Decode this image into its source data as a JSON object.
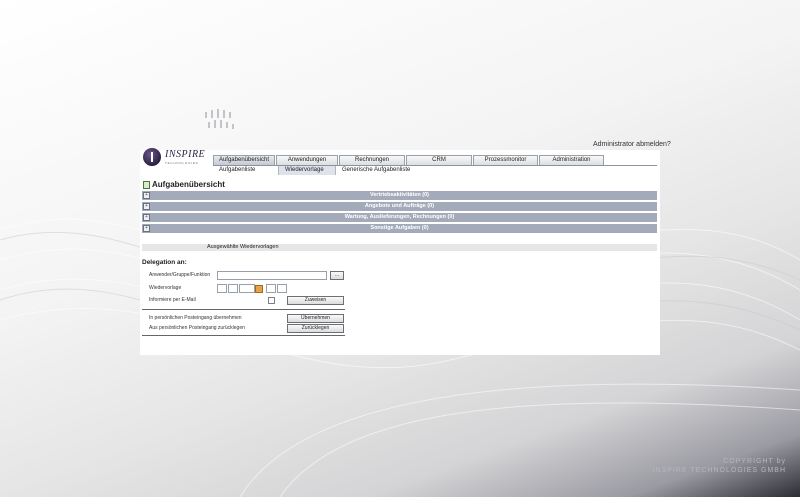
{
  "header": {
    "logout_label": "Administrator abmelden?",
    "logo_text": "INSPIRE",
    "logo_subtext": "TECHNOLOGIES"
  },
  "main_tabs": [
    {
      "label": "Aufgabenübersicht",
      "active": true
    },
    {
      "label": "Anwendungen",
      "active": false
    },
    {
      "label": "Rechnungen",
      "active": false
    },
    {
      "label": "CRM",
      "active": false
    },
    {
      "label": "Prozessmonitor",
      "active": false
    },
    {
      "label": "Administration",
      "active": false
    }
  ],
  "sub_tabs": [
    {
      "label": "Aufgabenliste",
      "active": false
    },
    {
      "label": "Wiedervorlage",
      "active": true
    },
    {
      "label": "Generische Aufgabenliste",
      "active": false
    }
  ],
  "page_title": "Aufgabenübersicht",
  "task_bars": [
    {
      "label": "Vertriebsaktivitäten (0)",
      "toggle": "+"
    },
    {
      "label": "Angebote und Aufträge (0)",
      "toggle": "+"
    },
    {
      "label": "Wartung, Auslieferungen, Rechnungen (0)",
      "toggle": "+"
    },
    {
      "label": "Sonstige Aufgaben (0)",
      "toggle": "+"
    }
  ],
  "section_header": "Ausgewählte Wiedervorlagen",
  "delegation": {
    "title": "Delegation an:",
    "user_label": "Anwender/Gruppe/Funktion",
    "user_value": "",
    "browse_label": "...",
    "resubmission_label": "Wiedervorlage",
    "email_label": "Informiere per E-Mail",
    "assign_button": "Zuweisen"
  },
  "inbox": {
    "take_label": "In persönlichen Posteingang übernehmen",
    "take_button": "Übernehmen",
    "return_label": "Aus persönlichen Posteingang zurücklegen",
    "return_button": "Zurücklegen"
  },
  "footer": {
    "copyright_line1": "COPYRIGHT by",
    "copyright_line2": "INSPIRE TECHNOLOGIES GMBH"
  }
}
